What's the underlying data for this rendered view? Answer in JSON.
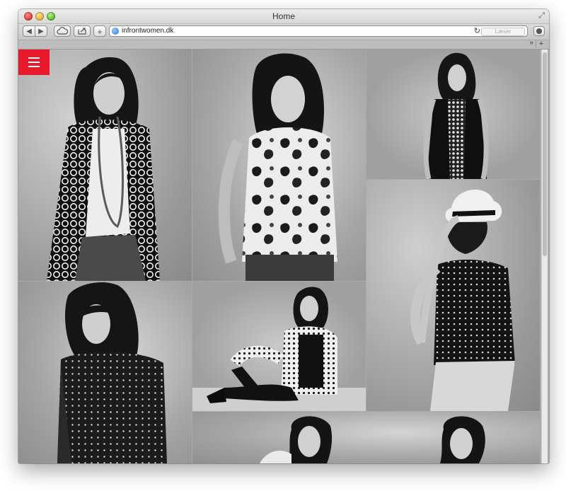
{
  "window": {
    "title": "Home"
  },
  "toolbar": {
    "back_icon": "back-icon",
    "forward_icon": "forward-icon",
    "url": "infrontwomen.dk",
    "reader_label": "Læser"
  },
  "tabs": {
    "overflow_glyph": "»",
    "new_tab_glyph": "+"
  },
  "page": {
    "menu_icon": "hamburger-menu-icon",
    "accent_color": "#e8192c",
    "gallery": [
      {
        "name": "woman-polka-dot-cardigan-photo"
      },
      {
        "name": "woman-floral-blouse-photo"
      },
      {
        "name": "woman-black-dress-photo"
      },
      {
        "name": "woman-white-hat-photo"
      },
      {
        "name": "woman-dotted-shirt-photo"
      },
      {
        "name": "woman-seated-heels-photo"
      },
      {
        "name": "women-bottom-row-photo"
      }
    ]
  }
}
